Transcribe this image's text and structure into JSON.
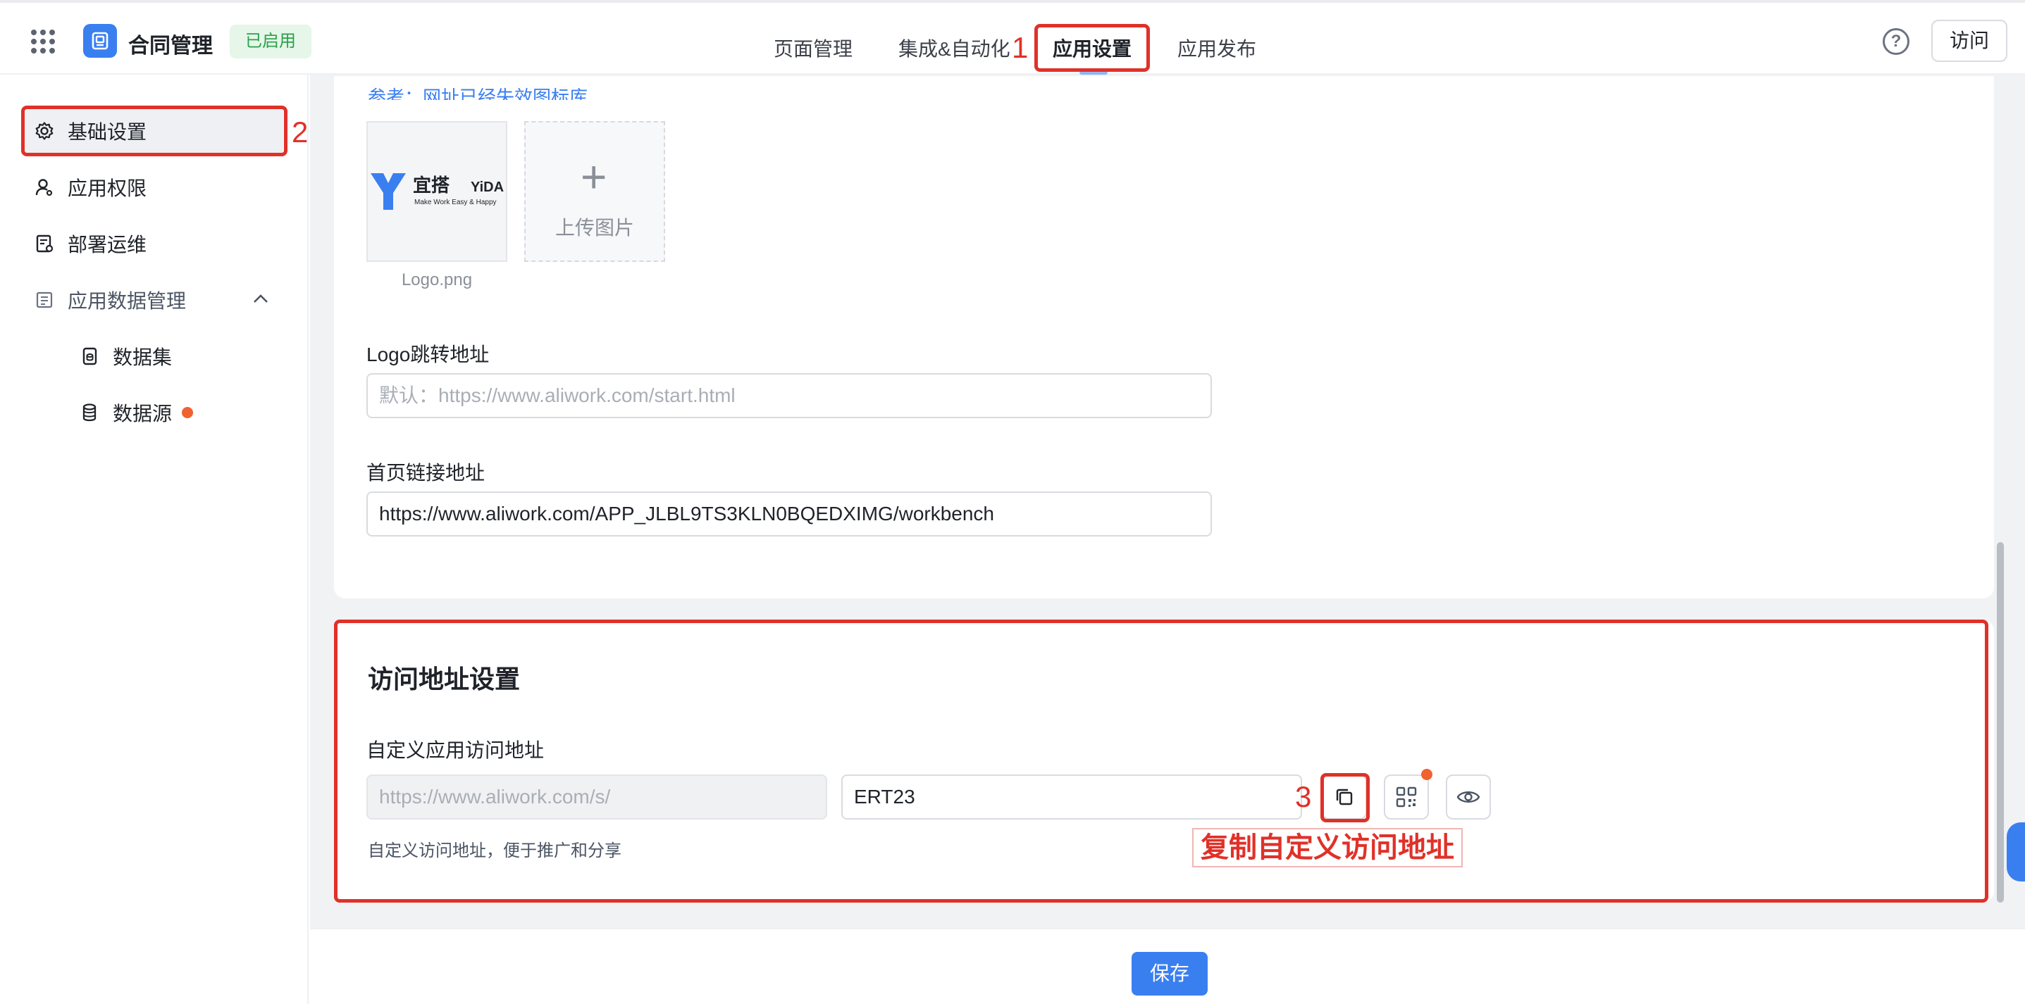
{
  "header": {
    "app_name": "合同管理",
    "status": "已启用",
    "tabs": [
      "页面管理",
      "集成&自动化",
      "应用设置",
      "应用发布"
    ],
    "active_tab": "应用设置",
    "help_icon": "?",
    "visit_label": "访问"
  },
  "sidebar": {
    "items": [
      {
        "label": "基础设置",
        "icon": "gear-icon"
      },
      {
        "label": "应用权限",
        "icon": "user-icon"
      },
      {
        "label": "部署运维",
        "icon": "deploy-icon"
      },
      {
        "label": "应用数据管理",
        "icon": "document-icon"
      },
      {
        "label": "数据集",
        "icon": "dataset-icon"
      },
      {
        "label": "数据源",
        "icon": "database-icon"
      }
    ]
  },
  "main": {
    "link_text_cut": "参考：网址已经失效图标库",
    "logo": {
      "brand_cn": "宜搭",
      "brand_en": "YiDA",
      "tagline": "Make Work Easy & Happy",
      "filename": "Logo.png"
    },
    "upload_label": "上传图片",
    "logo_jump": {
      "label": "Logo跳转地址",
      "placeholder": "默认：https://www.aliwork.com/start.html"
    },
    "home_link": {
      "label": "首页链接地址",
      "value": "https://www.aliwork.com/APP_JLBL9TS3KLN0BQEDXIMG/workbench"
    },
    "access": {
      "section_title": "访问地址设置",
      "field_label": "自定义应用访问地址",
      "prefix_placeholder": "https://www.aliwork.com/s/",
      "suffix_value": "ERT23",
      "hint": "自定义访问地址，便于推广和分享"
    },
    "save_label": "保存"
  },
  "annotations": {
    "n1": "1",
    "n2": "2",
    "n3": "3",
    "copy_tip": "复制自定义访问地址",
    "color": "#e03129"
  },
  "colors": {
    "primary": "#3a7ff0",
    "status_green": "#2aa14a",
    "badge_dot": "#f0622f"
  }
}
